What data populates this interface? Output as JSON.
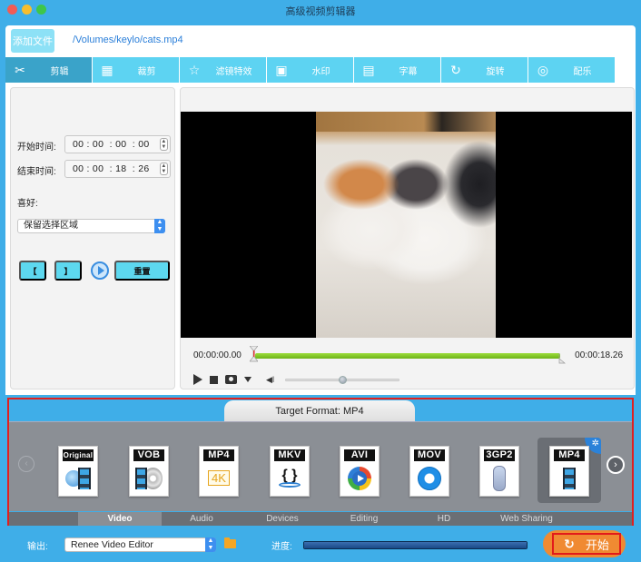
{
  "window": {
    "title": "高级视频剪辑器"
  },
  "filebar": {
    "add_file_label": "添加文件",
    "file_path": "/Volumes/keylo/cats.mp4"
  },
  "tabs": [
    {
      "label": "剪辑",
      "icon": "scissors-icon",
      "active": true
    },
    {
      "label": "裁剪",
      "icon": "crop-icon",
      "active": false
    },
    {
      "label": "滤镜特效",
      "icon": "stars-icon",
      "active": false
    },
    {
      "label": "水印",
      "icon": "watermark-icon",
      "active": false
    },
    {
      "label": "字幕",
      "icon": "subtitle-icon",
      "active": false
    },
    {
      "label": "旋转",
      "icon": "rotate-icon",
      "active": false
    },
    {
      "label": "配乐",
      "icon": "music-icon",
      "active": false
    }
  ],
  "trim": {
    "start_label": "开始时间:",
    "start_time": "00 : 00  : 00  : 00",
    "end_label": "结束时间:",
    "end_time": "00 : 00  : 18  : 26",
    "preference_label": "喜好:",
    "preference_value": "保留选择区域",
    "mark_in_label": "【",
    "mark_out_label": "】",
    "reset_label": "重置"
  },
  "player": {
    "current_time": "00:00:00.00",
    "end_time": "00:00:18.26",
    "selection_start_pct": 0,
    "selection_end_pct": 100,
    "volume_pct": 50
  },
  "format": {
    "target_label": "Target Format: MP4",
    "items": [
      {
        "label": "Original",
        "icon": "globe-film-icon"
      },
      {
        "label": "VOB",
        "icon": "disc-film-icon"
      },
      {
        "label": "MP4",
        "icon": "4k-icon",
        "sub": "4K"
      },
      {
        "label": "MKV",
        "icon": "matroska-icon",
        "sub": "{ }"
      },
      {
        "label": "AVI",
        "icon": "media-player-icon"
      },
      {
        "label": "MOV",
        "icon": "quicktime-icon"
      },
      {
        "label": "3GP2",
        "icon": "phone-icon"
      },
      {
        "label": "MP4",
        "icon": "film-icon",
        "selected": true
      }
    ],
    "categories": [
      {
        "label": "Video",
        "active": true
      },
      {
        "label": "Audio",
        "active": false
      },
      {
        "label": "Devices",
        "active": false
      },
      {
        "label": "Editing",
        "active": false
      },
      {
        "label": "HD",
        "active": false
      },
      {
        "label": "Web Sharing",
        "active": false
      }
    ]
  },
  "bottom": {
    "output_label": "输出:",
    "output_value": "Renee Video Editor",
    "progress_label": "进度:",
    "progress_pct": 100,
    "start_label": "开始"
  }
}
